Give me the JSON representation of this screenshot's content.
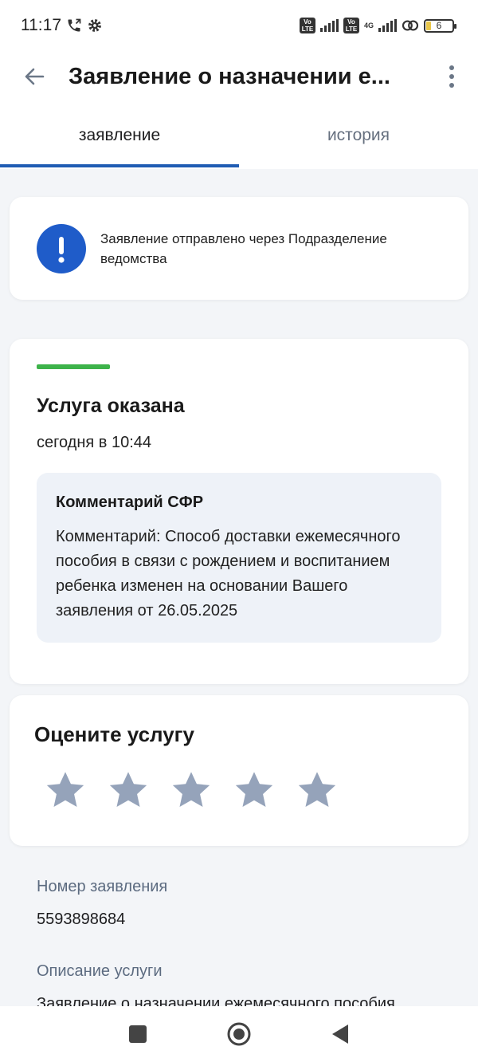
{
  "status_bar": {
    "time": "11:17",
    "network_badge_1": "Vo LTE",
    "network_badge_2": "Vo LTE",
    "network_type": "4G",
    "battery_level": "6"
  },
  "header": {
    "title": "Заявление о назначении е..."
  },
  "tabs": [
    {
      "label": "заявление",
      "active": true
    },
    {
      "label": "история",
      "active": false
    }
  ],
  "info_banner": {
    "text": "Заявление отправлено через Подразделение ведомства"
  },
  "status": {
    "title": "Услуга оказана",
    "date": "сегодня в 10:44",
    "comment_title": "Комментарий СФР",
    "comment_text": "Комментарий: Способ доставки ежемесячного пособия в связи с рождением и воспитанием ребенка изменен на основании Вашего заявления от 26.05.2025",
    "accent_color": "#3db34a"
  },
  "rating": {
    "title": "Оцените услугу",
    "stars": 5,
    "selected": 0,
    "star_color": "#95a3ba"
  },
  "details": {
    "number_label": "Номер заявления",
    "number_value": "5593898684",
    "description_label": "Описание услуги",
    "description_value": "Заявление о назначении ежемесячного пособия"
  },
  "colors": {
    "primary": "#1f5cb3",
    "info_icon": "#1f5cc9"
  }
}
